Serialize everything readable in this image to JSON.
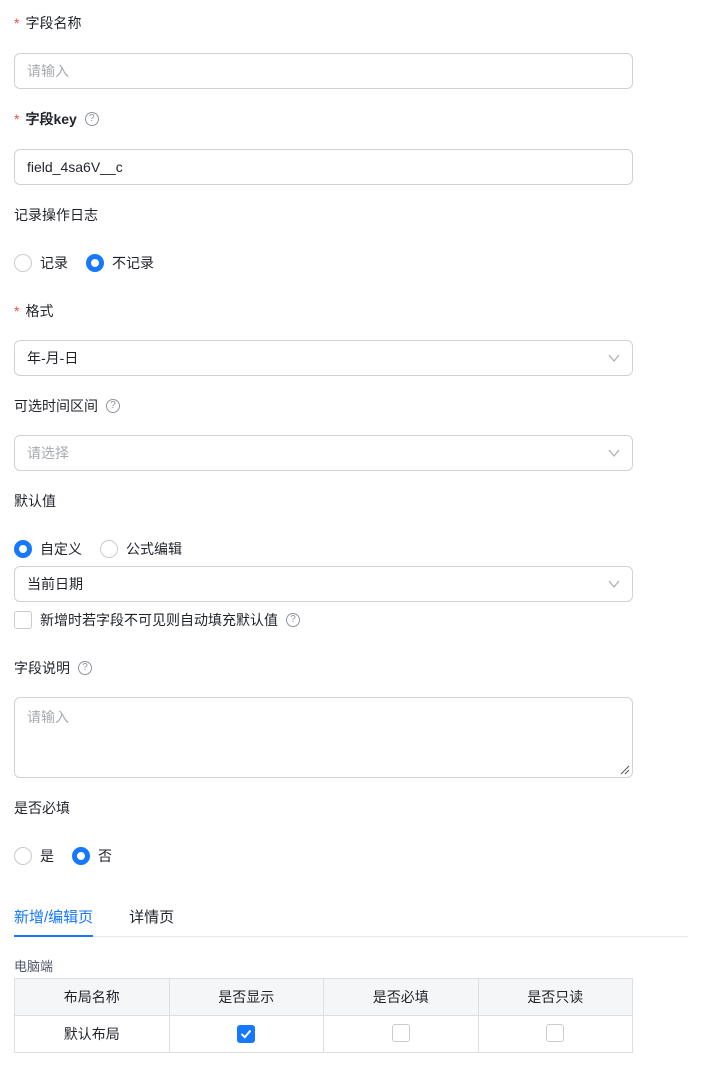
{
  "fields": {
    "field_name": {
      "required_mark": "*",
      "label": "字段名称",
      "placeholder": "请输入"
    },
    "field_key": {
      "required_mark": "*",
      "label": "字段key",
      "value": "field_4sa6V__c"
    },
    "log": {
      "label": "记录操作日志",
      "options": [
        "记录",
        "不记录"
      ],
      "selected": "不记录"
    },
    "format": {
      "required_mark": "*",
      "label": "格式",
      "value": "年-月-日"
    },
    "time_range": {
      "label": "可选时间区间",
      "placeholder": "请选择"
    },
    "default_value": {
      "label": "默认值",
      "options": [
        "自定义",
        "公式编辑"
      ],
      "selected": "自定义",
      "value": "当前日期",
      "autofill_label": "新增时若字段不可见则自动填充默认值",
      "autofill_checked": false
    },
    "description": {
      "label": "字段说明",
      "placeholder": "请输入"
    },
    "required": {
      "label": "是否必填",
      "options": [
        "是",
        "否"
      ],
      "selected": "否"
    }
  },
  "help_glyph": "?",
  "tabs": [
    "新增/编辑页",
    "详情页"
  ],
  "active_tab": "新增/编辑页",
  "layout_section": {
    "title": "电脑端",
    "columns": [
      "布局名称",
      "是否显示",
      "是否必填",
      "是否只读"
    ],
    "rows": [
      {
        "name": "默认布局",
        "show": true,
        "required": false,
        "readonly": false
      }
    ]
  },
  "colors": {
    "accent": "#1677ff",
    "required": "#f54a45",
    "border": "#d0d3d6"
  }
}
